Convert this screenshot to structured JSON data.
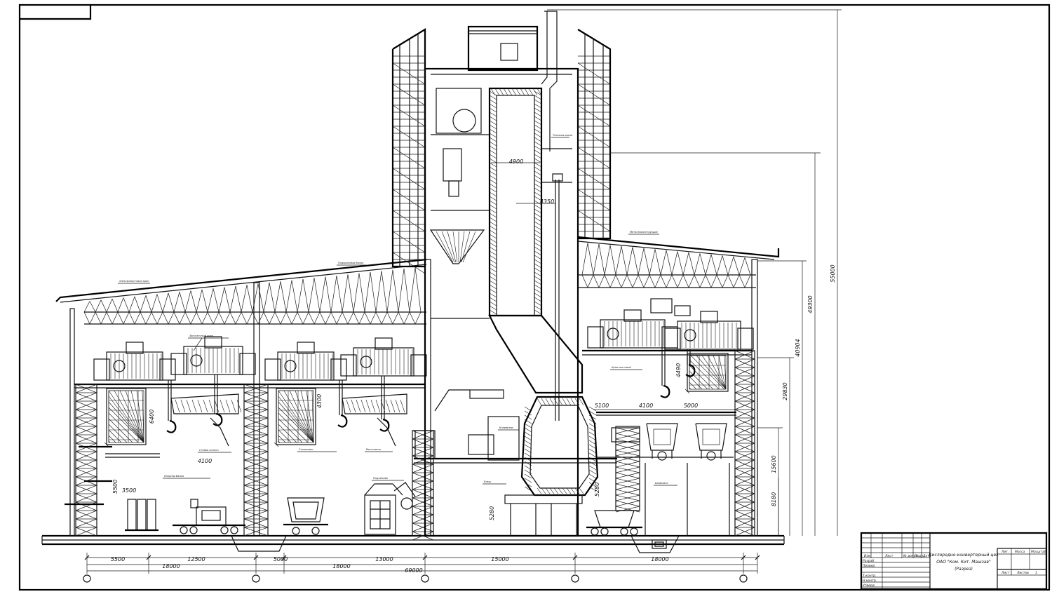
{
  "colors": {
    "ink": "#111111",
    "paper": "#ffffff"
  },
  "dimensions": {
    "bottom_row1": [
      "5500",
      "12500",
      "5000",
      "18000",
      "13000",
      "15000"
    ],
    "bottom_row2": [
      "18000",
      "18000",
      "18000"
    ],
    "bottom_total": "69000",
    "right_heights": [
      "55000",
      "49300",
      "40904",
      "29830",
      "15600",
      "8180"
    ],
    "shaft_widths": [
      "4900",
      "4350"
    ],
    "right_bay_spans": [
      "5100",
      "4100",
      "5000"
    ],
    "left_bay": [
      "4100",
      "6400",
      "3500",
      "5500"
    ],
    "mid_bay": [
      "4300"
    ],
    "center_heights": [
      "5280",
      "5280",
      "4490"
    ]
  },
  "labels": {
    "l1": "Электромостовой кран",
    "l2": "Подкрановая балка",
    "l3": "Загрузочный кран",
    "l4": "Стойки колонн",
    "l5": "Опорная балка",
    "l6": "Стальковш",
    "l7": "Вагон-весы",
    "l8": "Подъемник",
    "l9": "Конвертер",
    "l10": "Ковш",
    "l11": "Шлаковоз",
    "l12": "Металлоконструкция",
    "l13": "Кран мостовой",
    "l14": "Тележка крана"
  },
  "title_block": {
    "headers": [
      "Изм",
      "Лист",
      "№ докум.",
      "Подп.",
      "Дата"
    ],
    "roles": [
      "Разраб.",
      "Провер.",
      "Т.контр.",
      "Н.контр.",
      "Утверд."
    ],
    "title_lines": [
      "Кислородно-конвертерный цех",
      "ОАО \"Ком. Кит. Машзав\"",
      "(Разрез)"
    ],
    "col_headers": [
      "Лит.",
      "Масса",
      "Масштаб"
    ],
    "sheet": "Лист",
    "sheets": "Листов",
    "sheets_count": "1"
  }
}
